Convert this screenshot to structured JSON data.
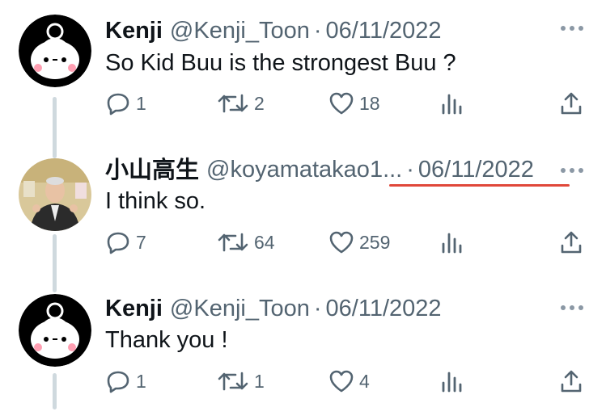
{
  "colors": {
    "secondary_text": "#536471",
    "thread_line": "#cfd9de",
    "highlight": "#e0483a"
  },
  "tweets": [
    {
      "name": "Kenji",
      "handle": "@Kenji_Toon",
      "separator": "·",
      "date": "06/11/2022",
      "text": "So Kid Buu is the strongest Buu ?",
      "avatar_icon": "cartoon-avatar-icon",
      "replies": "1",
      "retweets": "2",
      "likes": "18"
    },
    {
      "name": "小山高生",
      "handle": "@koyamatakao1...",
      "separator": "·",
      "date": "06/11/2022",
      "text": "I think so.",
      "avatar_icon": "photo-avatar-icon",
      "replies": "7",
      "retweets": "64",
      "likes": "259"
    },
    {
      "name": "Kenji",
      "handle": "@Kenji_Toon",
      "separator": "·",
      "date": "06/11/2022",
      "text": "Thank you !",
      "avatar_icon": "cartoon-avatar-icon",
      "replies": "1",
      "retweets": "1",
      "likes": "4"
    }
  ]
}
